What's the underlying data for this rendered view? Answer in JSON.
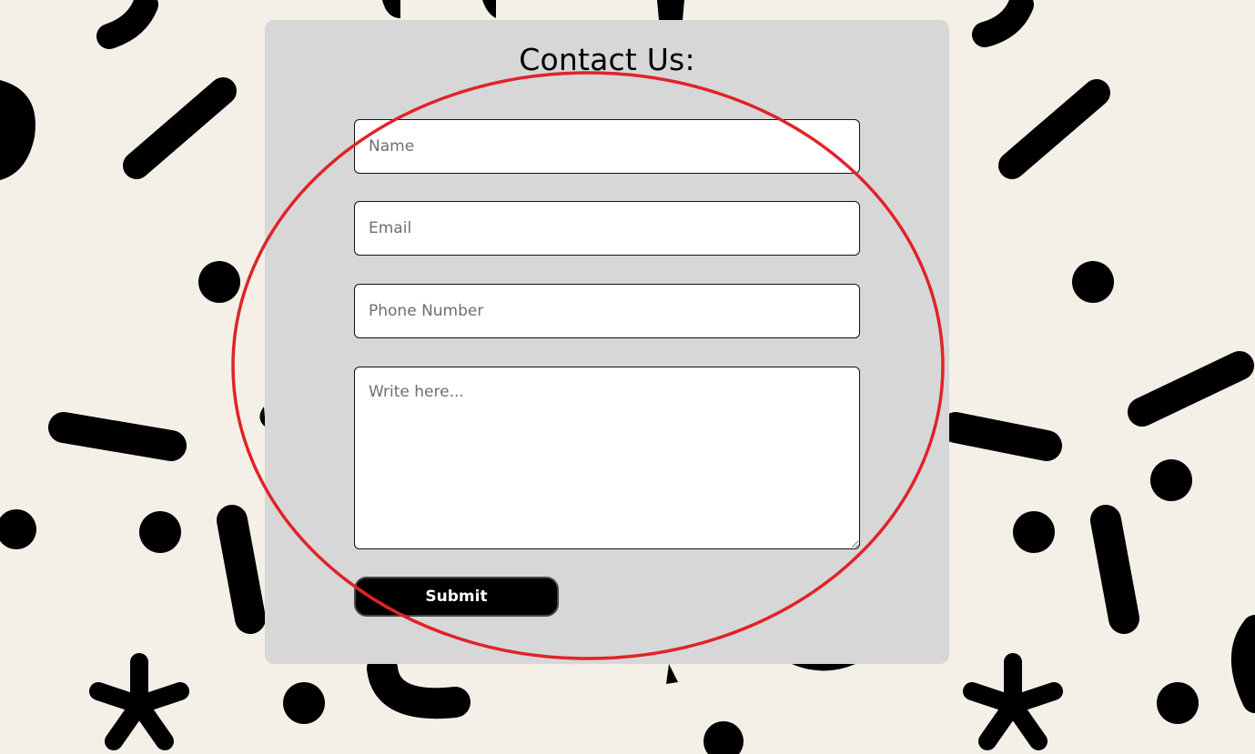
{
  "page": {
    "background_color": "#f4f0e8",
    "pattern_color": "#000000"
  },
  "form": {
    "title": "Contact Us:",
    "card_color": "#d7d7d8",
    "name_placeholder": "Name",
    "email_placeholder": "Email",
    "phone_placeholder": "Phone Number",
    "message_placeholder": "Write here...",
    "submit_label": "Submit"
  },
  "annotation": {
    "shape": "ellipse",
    "color": "#e02329"
  }
}
